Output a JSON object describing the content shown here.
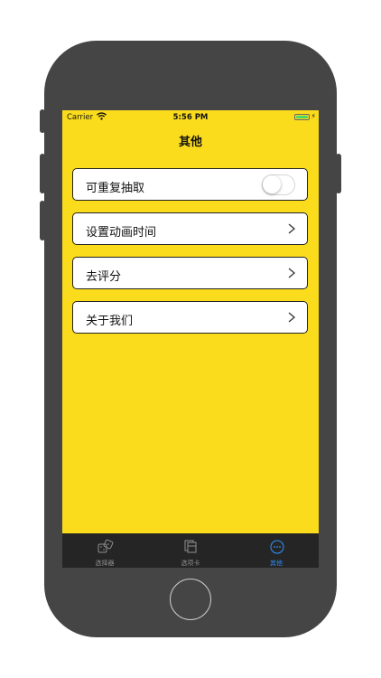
{
  "status_bar": {
    "carrier": "Carrier",
    "time": "5:56 PM"
  },
  "nav": {
    "title": "其他"
  },
  "settings": [
    {
      "label": "可重复抽取",
      "control": "toggle",
      "on": false
    },
    {
      "label": "设置动画时间",
      "control": "chevron"
    },
    {
      "label": "去评分",
      "control": "chevron"
    },
    {
      "label": "关于我们",
      "control": "chevron"
    }
  ],
  "tabs": [
    {
      "label": "选择器",
      "icon": "dice-icon",
      "selected": false
    },
    {
      "label": "选项卡",
      "icon": "cards-icon",
      "selected": false
    },
    {
      "label": "其他",
      "icon": "more-icon",
      "selected": true
    }
  ],
  "colors": {
    "background": "#fbdc1c",
    "tabbar": "#252525",
    "tab_selected": "#2f8cf0",
    "tab_unselected": "#8e8e8e",
    "phone_frame": "#454545"
  }
}
